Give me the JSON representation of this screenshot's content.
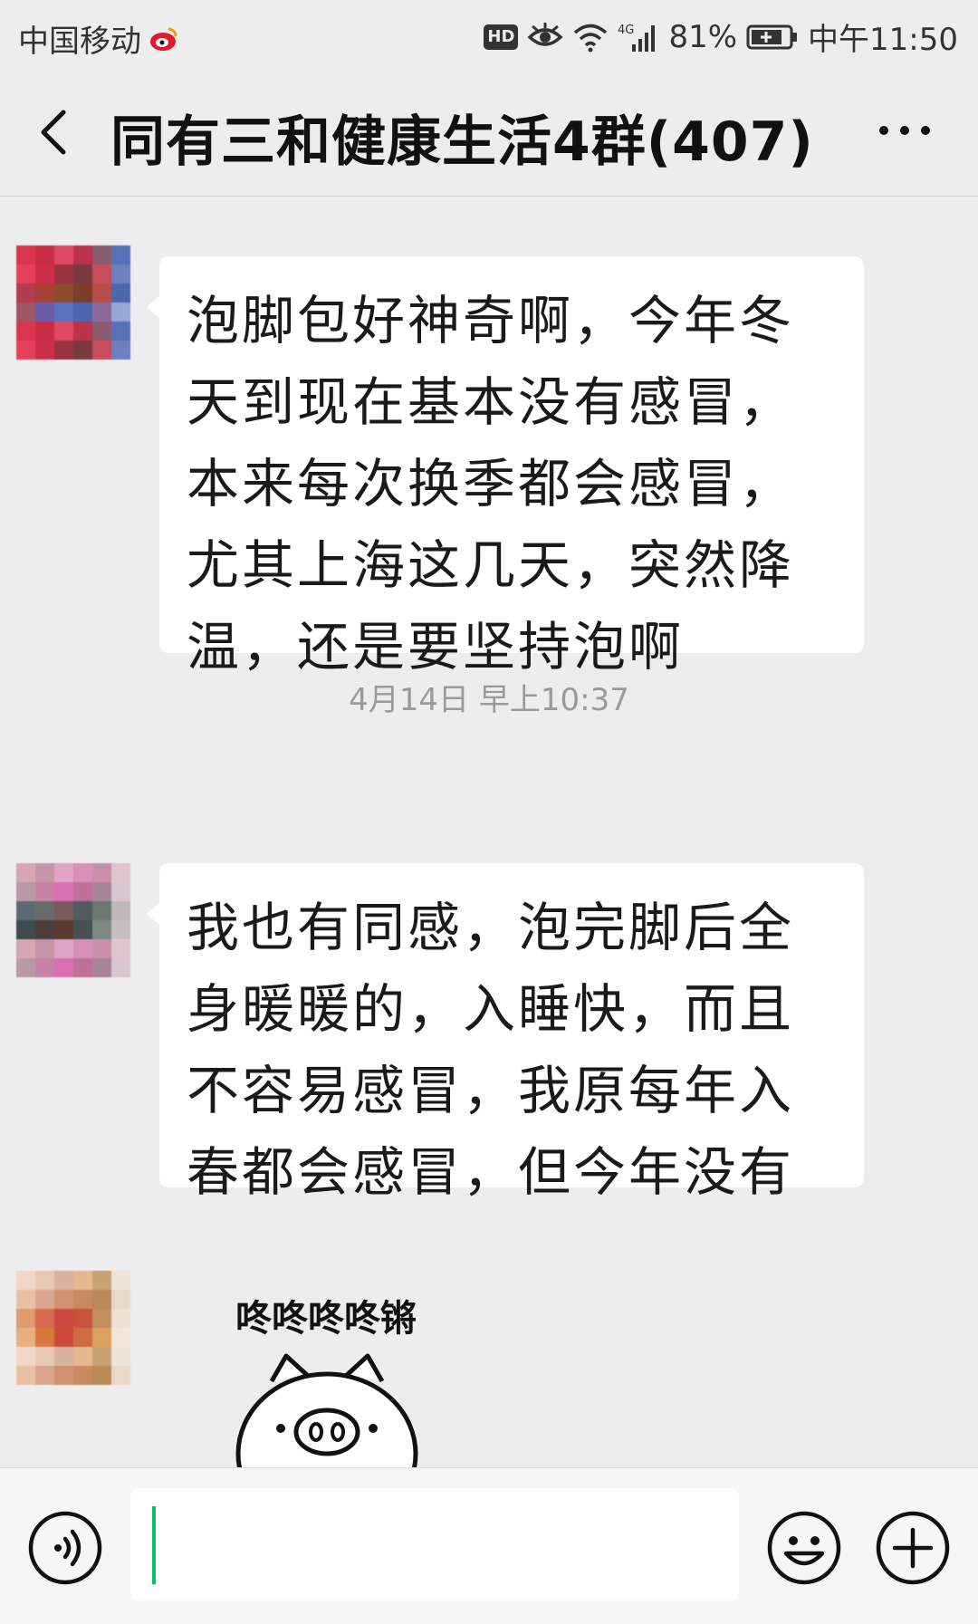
{
  "status_bar": {
    "carrier": "中国移动",
    "hd_badge": "HD",
    "network": "4G",
    "battery": "81%",
    "time": "中午11:50"
  },
  "header": {
    "title": "同有三和健康生活4群(407)"
  },
  "messages": [
    {
      "text": "泡脚包好神奇啊，今年冬天到现在基本没有感冒，本来每次换季都会感冒，尤其上海这几天，突然降温，还是要坚持泡啊"
    },
    {
      "text": "我也有同感，泡完脚后全身暖暖的，入睡快，而且不容易感冒，我原每年入春都会感冒，但今年没有"
    }
  ],
  "timestamp": "4月14日 早上10:37",
  "sticker": {
    "caption": "咚咚咚咚锵"
  },
  "input": {
    "value": ""
  },
  "icons": {
    "back": "chevron-left-icon",
    "more": "more-dots-icon",
    "voice": "voice-icon",
    "emoji": "emoji-icon",
    "plus": "plus-icon",
    "weibo": "weibo-icon",
    "eye": "eye-icon",
    "wifi": "wifi-icon",
    "signal": "signal-icon",
    "battery": "battery-icon"
  },
  "colors": {
    "background": "#ededed",
    "bubble": "#ffffff",
    "accent_cursor": "#07c160"
  }
}
